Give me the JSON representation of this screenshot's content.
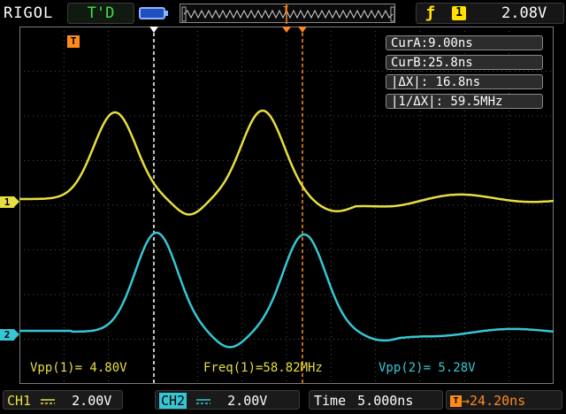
{
  "brand": "RIGOL",
  "trigger_status": "T'D",
  "trigger": {
    "edge_icon": "rising-edge-icon",
    "source": "1",
    "level": "2.08V"
  },
  "colors": {
    "ch1": "#e6df3f",
    "ch2": "#35c7d5",
    "cursor_a": "#ffffff",
    "cursor_b": "#ff8a1c",
    "trigger": "#ff8a1c",
    "grid": "#5a5a5a"
  },
  "trigger_marker": "T",
  "cursor_readouts": {
    "cur_a": "CurA:9.00ns",
    "cur_b": "CurB:25.8ns",
    "delta_x": "|ΔX|: 16.8ns",
    "inv_delta_x": "|1/ΔX|: 59.5MHz"
  },
  "channel_markers": {
    "ch1": "1",
    "ch2": "2"
  },
  "measurements": {
    "vpp1": "Vpp(1)= 4.80V",
    "freq1": "Freq(1)=58.82MHz",
    "vpp2": "Vpp(2)= 5.28V"
  },
  "bottom": {
    "ch1_label": "CH1",
    "ch1_scale": "2.00V",
    "ch2_label": "CH2",
    "ch2_scale": "2.00V",
    "time_label": "Time",
    "time_scale": "5.000ns",
    "trigger_offset": "24.20ns"
  }
}
